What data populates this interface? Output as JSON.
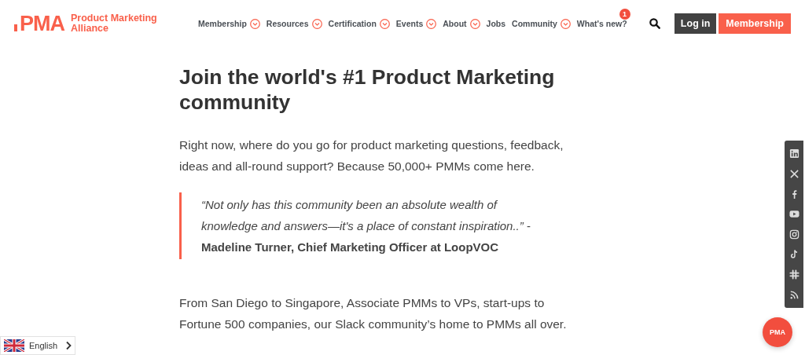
{
  "header": {
    "logo": {
      "mark": "PMA",
      "name_line1": "Product Marketing",
      "name_line2": "Alliance"
    },
    "nav": [
      {
        "label": "Membership",
        "dropdown": true
      },
      {
        "label": "Resources",
        "dropdown": true
      },
      {
        "label": "Certification",
        "dropdown": true
      },
      {
        "label": "Events",
        "dropdown": true
      },
      {
        "label": "About",
        "dropdown": true
      },
      {
        "label": "Jobs",
        "dropdown": false
      },
      {
        "label": "Community",
        "dropdown": true
      },
      {
        "label": "What's new?",
        "dropdown": false,
        "badge": "1"
      }
    ],
    "login": "Log in",
    "membership_button": "Membership"
  },
  "main": {
    "heading": "Join the world's #1 Product Marketing community",
    "intro": "Right now, where do you go for product marketing questions, feedback, ideas and all-round support? Because 50,000+ PMMs come here.",
    "quote": "*“Not only has this community been an absolute wealth of knowledge and answers—it's a place of constant inspiration..”* - **Madeline Turner, Chief Marketing Officer at LoopVOC**",
    "body": "From San Diego to Singapore, Associate PMMs to VPs, start-ups to Fortune 500 companies, our Slack community’s home to PMMs all over."
  },
  "language": {
    "label": "English"
  },
  "chat_button": {
    "label": "PMA"
  }
}
